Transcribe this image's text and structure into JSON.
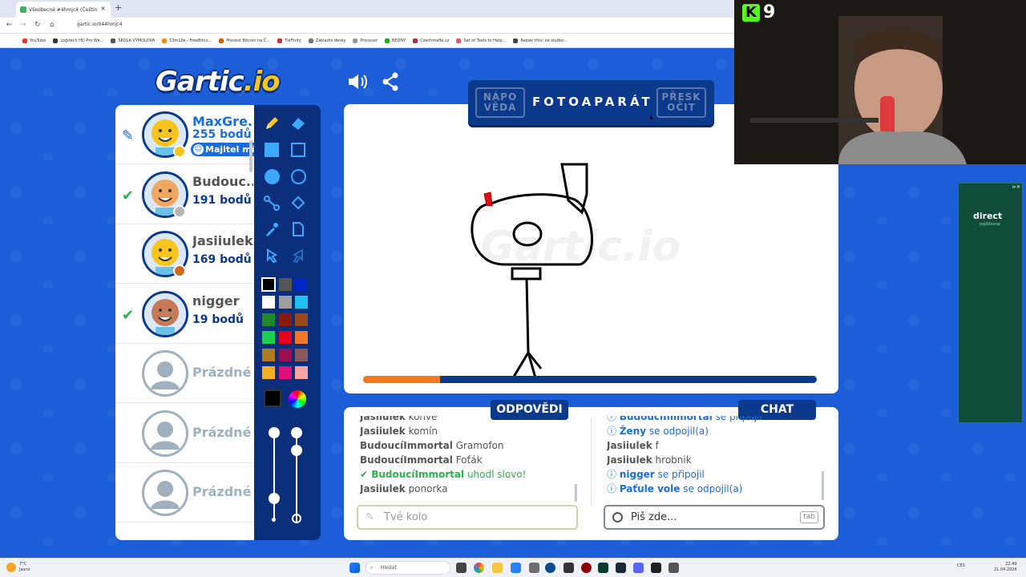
{
  "browser": {
    "tab_title": "Všeobecné #4hmjc4 (Češtin",
    "url": "gartic.io/044hmjc4",
    "bookmarks": [
      "YouTube",
      "Logitech HD Pro We...",
      "ŠKOLA VÝMOLOVA",
      "53m10s - FreeBitco...",
      "Převést Bitcoin na Č...",
      "TikFinity",
      "Základní desky",
      "Procesor",
      "BEDNY",
      "Czechmafie.cz",
      "Set of Tools to Help...",
      "Repair this! ve službo..."
    ]
  },
  "game": {
    "logo_main": "Gartic",
    "logo_suffix": ".io",
    "players": [
      {
        "name": "MaxGre...",
        "points": "255 bodů",
        "badge": "Majitel mís",
        "status_color": "#f7c51d",
        "mark": "pencil"
      },
      {
        "name": "Budouc...",
        "points": "191 bodů",
        "status_color": "#b5b5b5",
        "mark": "check"
      },
      {
        "name": "Jasiiulek",
        "points": "169 bodů",
        "status_color": "#d2691e",
        "mark": ""
      },
      {
        "name": "nigger",
        "points": "19 bodů",
        "status_color": "",
        "mark": "check"
      },
      {
        "name": "Prázdné"
      },
      {
        "name": "Prázdné"
      },
      {
        "name": "Prázdné"
      }
    ],
    "word_bar": {
      "hint_button": "NÁPO\nVĚDA",
      "word": "FOTOAPARÁT",
      "skip_button": "PŘESK\nOČIT"
    },
    "timer_progress": 0.17,
    "answers_title": "ODPOVĚDI",
    "chat_title": "CHAT",
    "answers": [
      {
        "user": "Jasiiulek",
        "text": "konve"
      },
      {
        "user": "Jasiiulek",
        "text": "komín"
      },
      {
        "user": "BudoucíImmortal",
        "text": "Gramofon"
      },
      {
        "user": "BudoucíImmortal",
        "text": "Foťák"
      },
      {
        "user": "BudoucíImmortal",
        "text": "uhodl slovo!",
        "correct": true
      },
      {
        "user": "Jasiiulek",
        "text": "ponorka"
      }
    ],
    "chat": [
      {
        "user": "BudoucíImmortal",
        "text": "se připojil",
        "info": true
      },
      {
        "user": "Ženy",
        "text": "se odpojil(a)",
        "info": true
      },
      {
        "user": "Jasiiulek",
        "text": "f"
      },
      {
        "user": "Jasiiulek",
        "text": "hrobnik"
      },
      {
        "user": "nigger",
        "text": "se připojil",
        "info": true
      },
      {
        "user": "Paťule vole",
        "text": "se odpojil(a)",
        "info": true
      }
    ],
    "answer_placeholder": "Tvé kolo",
    "chat_placeholder": "Piš zde...",
    "chat_key_hint": "tab"
  },
  "stream": {
    "kick_count": "9"
  },
  "ad": {
    "brand": "direct",
    "sub": "pojišťovna"
  },
  "taskbar": {
    "weather_temp": "7°C",
    "weather_desc": "Jasno",
    "search_placeholder": "Hledat",
    "lang": "CES",
    "time": "22:49",
    "date": "21.04.2026"
  }
}
